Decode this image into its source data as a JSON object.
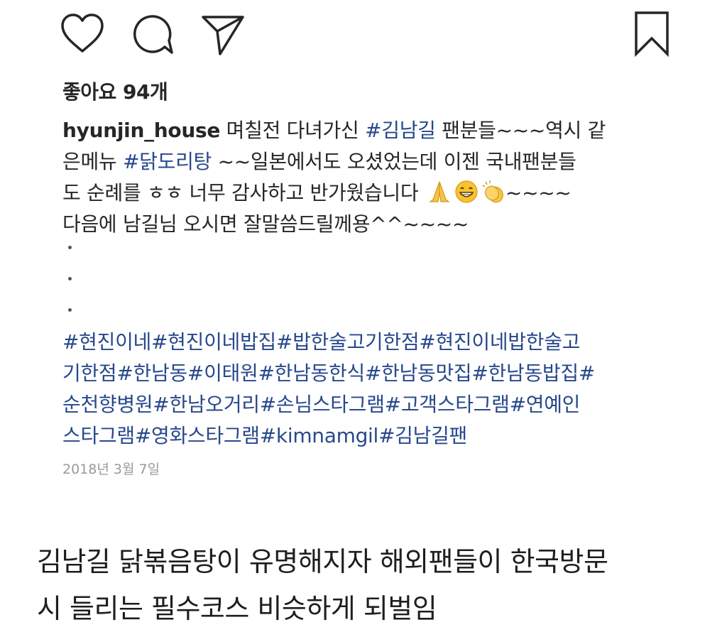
{
  "actions": {
    "like_icon": "heart-icon",
    "comment_icon": "comment-icon",
    "share_icon": "paper-plane-icon",
    "save_icon": "bookmark-icon"
  },
  "likes": {
    "label": "좋아요 94개"
  },
  "caption": {
    "username": "hyunjin_house",
    "line1_text": " 며칠전 다녀가신 ",
    "line1_tag": "#김남길",
    "line1_tail": " 팬분들~~~역시 같",
    "line2_head": "은메뉴 ",
    "line2_tag": "#닭도리탕",
    "line2_tail": " ~~일본에서도 오셨었는데 이젠 국내팬분들",
    "line3_text": "도 순례를 ㅎㅎ 너무 감사하고 반가웠습니다",
    "line3_emojis": [
      "folded-hands-emoji",
      "grinning-face-emoji",
      "clapping-hands-emoji"
    ],
    "line3_tail": "~~~~",
    "line4_text": "다음에 남길님 오시면 잘말씀드릴께용^^~~~~"
  },
  "hashtags": {
    "line1": "#현진이네#현진이네밥집#밥한술고기한점#현진이네밥한술고",
    "line2": "기한점#한남동#이태원#한남동한식#한남동맛집#한남동밥집#",
    "line3": "순천향병원#한남오거리#손님스타그램#고객스타그램#연예인",
    "line4": "스타그램#영화스타그램#kimnamgil#김남길팬"
  },
  "date": "2018년 3월 7일",
  "comment": {
    "line1": "김남길 닭볶음탕이 유명해지자 해외팬들이 한국방문",
    "line2": "시 들리는 필수코스 비슷하게 되벌임"
  },
  "colors": {
    "hashtag": "#27488c",
    "text": "#262626",
    "date": "#9a9a9a"
  }
}
